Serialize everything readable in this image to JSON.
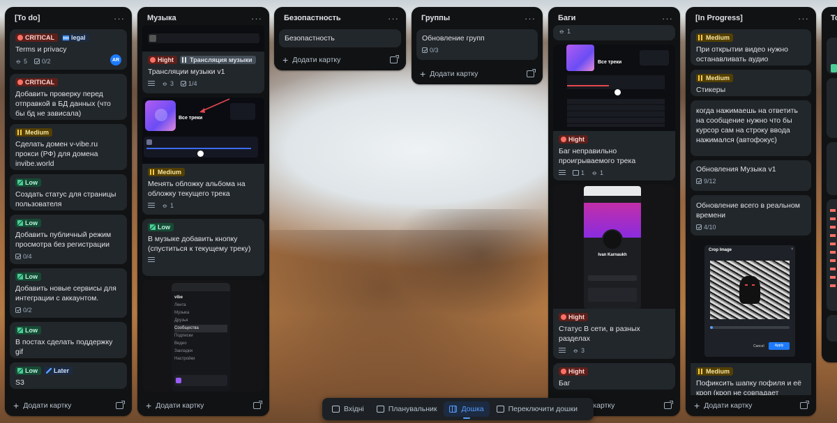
{
  "columns": {
    "todo": {
      "title": "[To do]",
      "add_label": "Додати картку",
      "cards": [
        {
          "badges": [
            "CRITICAL",
            "legal"
          ],
          "title": "Terms и privacy",
          "attachments": "5",
          "checklist": "0/2",
          "avatar": "AR"
        },
        {
          "badges": [
            "CRITICAL"
          ],
          "title": "Добавить проверку перед отправкой в БД данных (что бы бд не зависала)"
        },
        {
          "badges": [
            "Medium"
          ],
          "title": "Сделать домен v-vibe.ru прокси (РФ) для домена invibe.world"
        },
        {
          "badges": [
            "Low"
          ],
          "title": "Создать статус для страницы пользователя"
        },
        {
          "badges": [
            "Low"
          ],
          "title": "Добавить публичный режим просмотра без регистрации",
          "checklist": "0/4"
        },
        {
          "badges": [
            "Low"
          ],
          "title": "Добавить новые сервисы для интеграции с аккаунтом.",
          "checklist": "0/2"
        },
        {
          "badges": [
            "Low"
          ],
          "title": "В постах сделать поддержку gif"
        },
        {
          "badges": [
            "Low",
            "Later"
          ],
          "title": "S3"
        }
      ]
    },
    "music": {
      "title": "Музыка",
      "add_label": "Додати картку",
      "cards": [
        {
          "badges": [
            "Hight",
            "Трансляция музыки"
          ],
          "title": "Трансляции музыки v1",
          "attachments": "3",
          "checklist": "1/4"
        },
        {
          "badges": [
            "Medium"
          ],
          "title": "Менять обложку альбома на обложку текущего трека",
          "attachments": "1",
          "thumb_text": "Все треки"
        },
        {
          "badges": [
            "Low"
          ],
          "title": "В музыке добавить кнопку (спуститься к текущему треку)"
        }
      ],
      "phone_menu": [
        "vibe",
        "Лента",
        "Музыка",
        "Друзья",
        "Сообщества",
        "Подписки",
        "Видео",
        "Закладки",
        "Настройки"
      ]
    },
    "security": {
      "title": "Безопастность",
      "add_label": "Додати картку",
      "cards": [
        {
          "title": "Безопастность"
        }
      ]
    },
    "groups": {
      "title": "Группы",
      "add_label": "Додати картку",
      "cards": [
        {
          "title": "Обновление групп",
          "checklist": "0/3"
        }
      ]
    },
    "bugs": {
      "title": "Баги",
      "add_label": "Додати картку",
      "top_count": "1",
      "cards": [
        {
          "badges": [
            "Hight"
          ],
          "title": "Баг неправильно проигрываемого трека",
          "comments": "1",
          "attachments": "1",
          "thumb_text": "Все треки"
        },
        {
          "badges": [
            "Hight"
          ],
          "title": "Статус В сети, в разных разделах",
          "attachments": "3",
          "thumb_text": "Ivan Karnaukh"
        },
        {
          "badges": [
            "Hight"
          ],
          "title": "Баг"
        }
      ]
    },
    "inprogress": {
      "title": "[In Progress]",
      "add_label": "Додати картку",
      "cards": [
        {
          "badges": [
            "Medium"
          ],
          "title": "При открытии видео нужно останавливать аудио"
        },
        {
          "badges": [
            "Medium"
          ],
          "title": "Стикеры"
        },
        {
          "title": "когда нажимаешь на ответить на сообщение нужно что бы курсор сам на строку ввода нажимался (автофокус)"
        },
        {
          "title": "Обновления Музыка v1",
          "checklist": "9/12"
        },
        {
          "title": "Обновление всего в реальном времени",
          "checklist": "4/10"
        },
        {
          "badges": [
            "Medium"
          ],
          "title": "Пофиксить шапку пофиля и её кроп (кроп не совпадает",
          "thumb_text": "Crop Image",
          "crop_cancel": "Cancel",
          "crop_apply": "Apply"
        }
      ]
    },
    "partial": {
      "title": "To"
    }
  },
  "bottom_nav": {
    "items": [
      "Вхідні",
      "Планувальник",
      "Дошка",
      "Переключити дошки"
    ],
    "active": "Дошка"
  },
  "colors": {
    "column_bg": "#111213",
    "card_bg": "#22272b",
    "accent": "#579dff"
  }
}
